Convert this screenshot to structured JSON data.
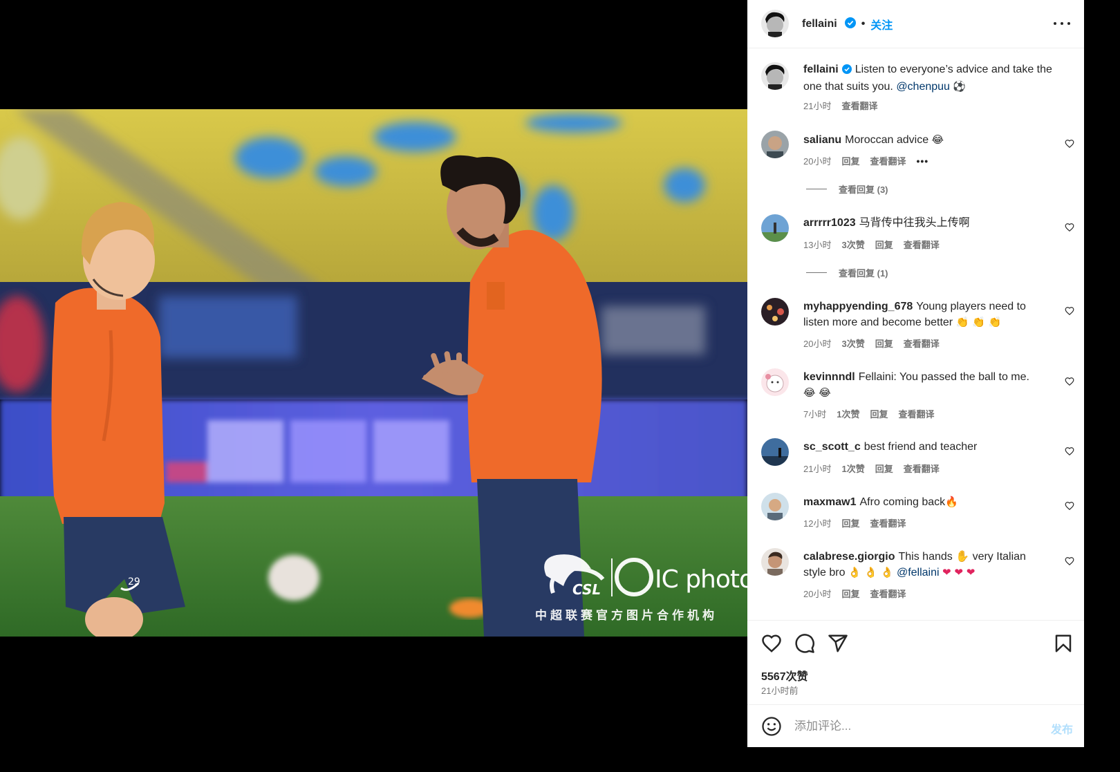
{
  "photo": {
    "watermark_logo_csl": "CSL",
    "watermark_logo_ic": "IC photo",
    "watermark_subtitle": "中超联赛官方图片合作机构",
    "jersey_number": "29"
  },
  "header": {
    "username": "fellaini",
    "separator": "•",
    "follow_label": "关注",
    "more_icon": "more-horizontal-icon"
  },
  "caption": {
    "username": "fellaini",
    "text": "Listen to everyone’s advice and take the one that suits you.",
    "mention": "@chenpuu",
    "emoji": "⚽",
    "time": "21小时",
    "translate": "查看翻译"
  },
  "comments": [
    {
      "username": "salianu",
      "text": "Moroccan advice",
      "emoji": "😂",
      "time": "20小时",
      "likes": "",
      "reply": "回复",
      "translate": "查看翻译",
      "more": "•••",
      "view_replies": "查看回复 (3)"
    },
    {
      "username": "arrrrr1023",
      "text": "马背传中往我头上传啊",
      "emoji": "",
      "time": "13小时",
      "likes": "3次赞",
      "reply": "回复",
      "translate": "查看翻译",
      "view_replies": "查看回复 (1)"
    },
    {
      "username": "myhappyending_678",
      "text": "Young players need to listen more and become better",
      "emoji": "👏 👏 👏",
      "time": "20小时",
      "likes": "3次赞",
      "reply": "回复",
      "translate": "查看翻译"
    },
    {
      "username": "kevinnndl",
      "text": "Fellaini: You passed the ball to me.",
      "emoji": "😂 😂",
      "time": "7小时",
      "likes": "1次赞",
      "reply": "回复",
      "translate": "查看翻译"
    },
    {
      "username": "sc_scott_c",
      "text": "best friend and teacher",
      "emoji": "",
      "time": "21小时",
      "likes": "1次赞",
      "reply": "回复",
      "translate": "查看翻译"
    },
    {
      "username": "maxmaw1",
      "text": "Afro coming back",
      "emoji": "🔥",
      "time": "12小时",
      "likes": "",
      "reply": "回复",
      "translate": "查看翻译"
    },
    {
      "username": "calabrese.giorgio",
      "text": "This hands ✋ very Italian style bro",
      "emoji": "👌 👌 👌",
      "mention": "@fellaini",
      "hearts": "❤ ❤ ❤",
      "time": "20小时",
      "likes": "",
      "reply": "回复",
      "translate": "查看翻译"
    }
  ],
  "actions": {
    "like_icon": "heart-icon",
    "comment_icon": "comment-bubble-icon",
    "share_icon": "paper-plane-icon",
    "save_icon": "bookmark-icon",
    "likes_count": "5567次赞",
    "post_time": "21小时前"
  },
  "composer": {
    "emoji_icon": "smiley-icon",
    "placeholder": "添加评论...",
    "post_label": "发布"
  },
  "colors": {
    "accent": "#0095f6",
    "post_disabled": "#b2dffc",
    "verified": "#0095f6",
    "jersey": "#ef6a2a"
  }
}
